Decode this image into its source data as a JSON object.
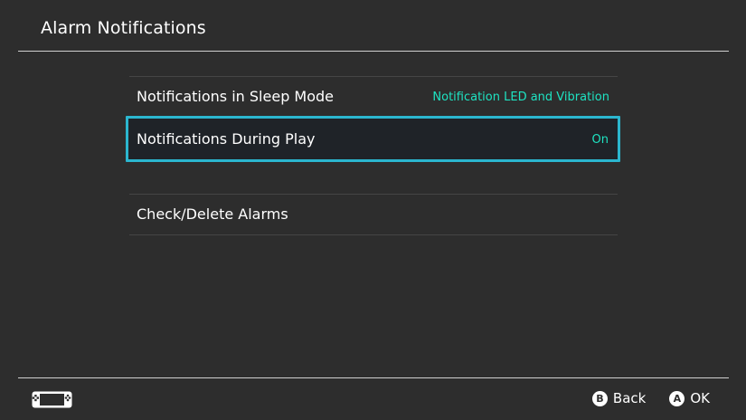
{
  "header": {
    "title": "Alarm Notifications"
  },
  "menu": {
    "items": [
      {
        "label": "Notifications in Sleep Mode",
        "value": "Notification LED and Vibration"
      },
      {
        "label": "Notifications During Play",
        "value": "On",
        "selected": true
      },
      {
        "label": "Check/Delete Alarms"
      }
    ]
  },
  "footer": {
    "back": {
      "glyph": "B",
      "label": "Back"
    },
    "ok": {
      "glyph": "A",
      "label": "OK"
    },
    "console_icon": "handheld-console-icon"
  },
  "colors": {
    "background": "#2d2d2d",
    "accent_value": "#1ee3c2",
    "selection_border": "#2bb6cf"
  }
}
